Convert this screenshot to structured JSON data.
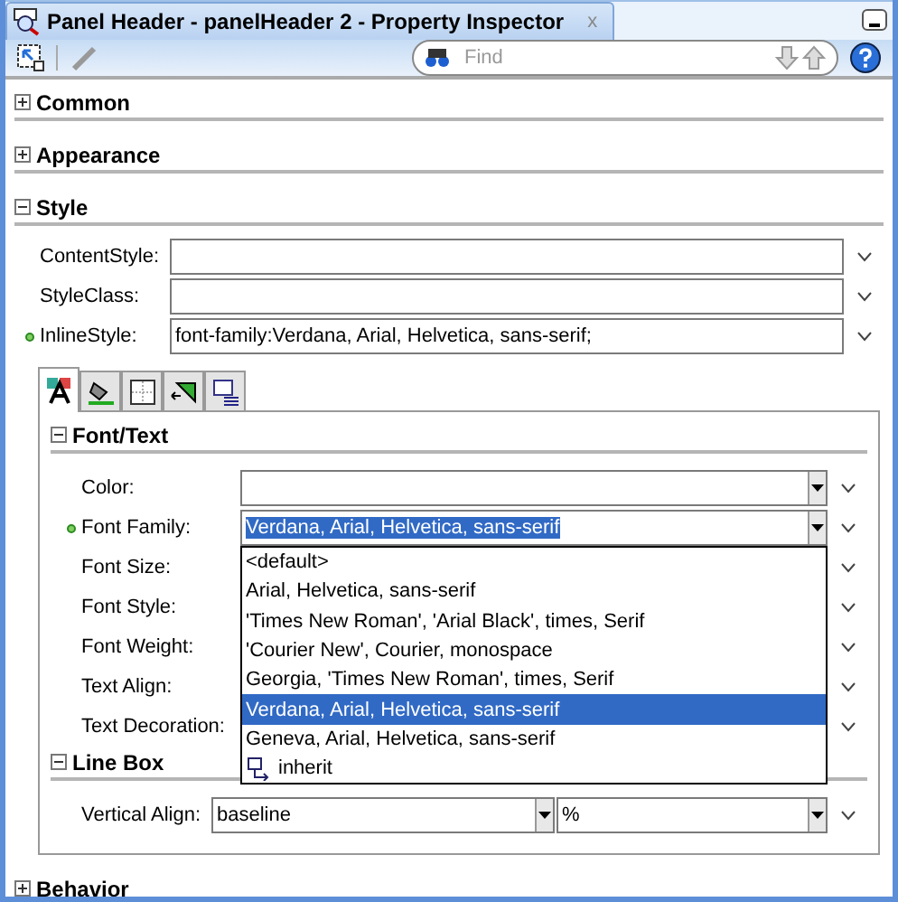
{
  "window": {
    "title": "Panel Header - panelHeader 2 - Property Inspector",
    "close": "x"
  },
  "toolbar": {
    "search": {
      "placeholder": "Find"
    }
  },
  "sections": [
    {
      "title": "Common",
      "expanded": false
    },
    {
      "title": "Appearance",
      "expanded": false
    },
    {
      "title": "Style",
      "expanded": true,
      "properties": [
        {
          "label": "ContentStyle:",
          "modified": false
        },
        {
          "label": "StyleClass:",
          "modified": false
        },
        {
          "label": "InlineStyle:",
          "modified": true,
          "value": "font-family:Verdana, Arial, Helvetica, sans-serif;"
        }
      ],
      "style_tabs": [
        {
          "selected": true
        },
        {
          "selected": false
        },
        {
          "selected": false
        },
        {
          "selected": false
        },
        {
          "selected": false
        }
      ],
      "groups": [
        {
          "title": "Font/Text",
          "expanded": true,
          "properties": [
            {
              "label": "Color:",
              "kind": "combo",
              "modified": false
            },
            {
              "label": "Font Family:",
              "kind": "combo",
              "modified": true,
              "value": "Verdana, Arial, Helvetica, sans-serif",
              "open": true,
              "options": [
                {
                  "label": "<default>",
                  "kind": "text",
                  "selected": false
                },
                {
                  "label": "Arial, Helvetica, sans-serif",
                  "kind": "text",
                  "selected": false
                },
                {
                  "label": "'Times New Roman', 'Arial Black', times, Serif",
                  "kind": "text",
                  "selected": false
                },
                {
                  "label": "'Courier New', Courier, monospace",
                  "kind": "text",
                  "selected": false
                },
                {
                  "label": "Georgia, 'Times New Roman', times, Serif",
                  "kind": "text",
                  "selected": false
                },
                {
                  "label": "Verdana, Arial, Helvetica, sans-serif",
                  "kind": "text",
                  "selected": true
                },
                {
                  "label": "Geneva, Arial, Helvetica, sans-serif",
                  "kind": "text",
                  "selected": false
                },
                {
                  "label": "inherit",
                  "kind": "inherit",
                  "selected": false
                }
              ]
            },
            {
              "label": "Font Size:",
              "kind": "covered",
              "modified": false
            },
            {
              "label": "Font Style:",
              "kind": "covered",
              "modified": false
            },
            {
              "label": "Font Weight:",
              "kind": "covered",
              "modified": false
            },
            {
              "label": "Text Align:",
              "kind": "covered",
              "modified": false
            },
            {
              "label": "Text Decoration:",
              "kind": "covered",
              "modified": false
            }
          ]
        },
        {
          "title": "Line Box",
          "expanded": true,
          "properties": [
            {
              "label": "Vertical Align:",
              "kind": "pair",
              "modified": false,
              "value": "baseline",
              "unit": "%"
            }
          ]
        }
      ]
    },
    {
      "title": "Behavior",
      "expanded": false
    }
  ]
}
